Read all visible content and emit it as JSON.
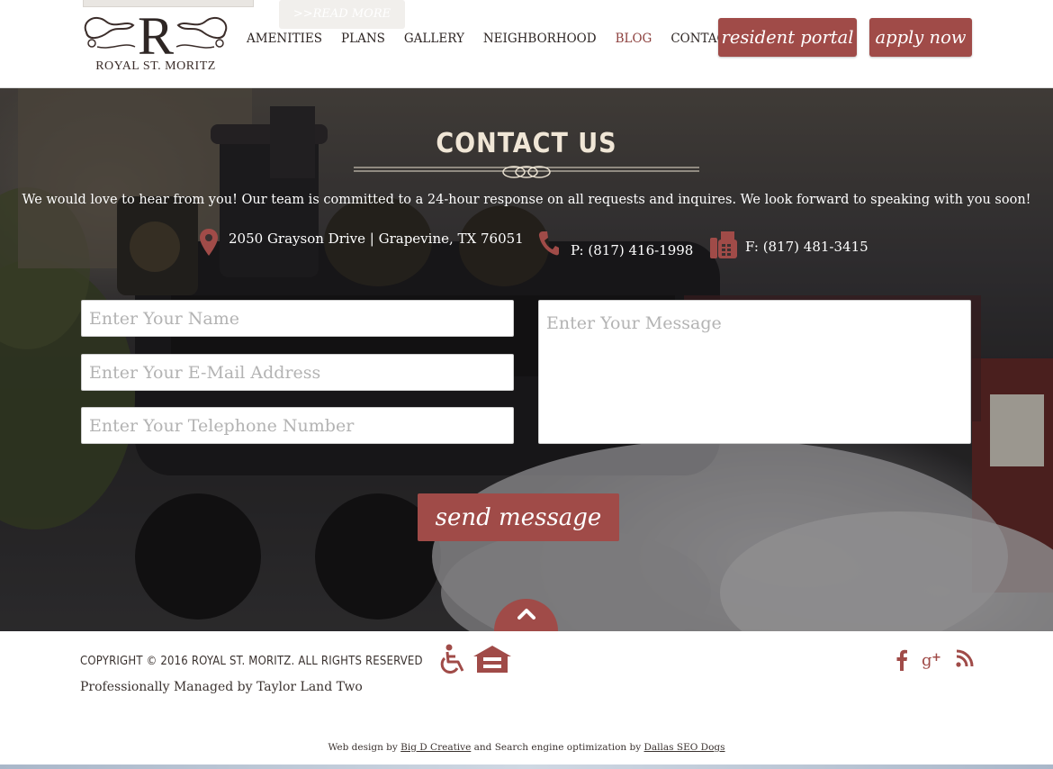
{
  "header": {
    "ghost_read_more": ">>READ MORE",
    "logo_text": "ROYAL ST. MORITZ",
    "logo_letter": "R",
    "nav": [
      {
        "label": "AMENITIES"
      },
      {
        "label": "PLANS"
      },
      {
        "label": "GALLERY"
      },
      {
        "label": "NEIGHBORHOOD"
      },
      {
        "label": "BLOG",
        "active": true
      },
      {
        "label": "CONTACT"
      }
    ],
    "resident_portal": "resident portal",
    "apply_now": "apply now"
  },
  "contact": {
    "title": "CONTACT US",
    "intro": "We would love to hear from you! Our team is committed to a 24-hour response on all requests and inquires. We look forward to speaking with you soon!",
    "address": "2050 Grayson Drive | Grapevine, TX 76051",
    "phone": "P: (817) 416-1998",
    "fax": "F: (817) 481-3415",
    "form": {
      "name_placeholder": "Enter Your Name",
      "email_placeholder": "Enter Your E-Mail Address",
      "phone_placeholder": "Enter Your Telephone Number",
      "message_placeholder": "Enter Your Message",
      "send_label": "send message"
    }
  },
  "footer": {
    "copyright": "COPYRIGHT © 2016 ROYAL ST. MORITZ. ALL RIGHTS RESERVED",
    "managed": "Professionally Managed by Taylor Land Two",
    "credits_prefix": "Web design by",
    "credits_link1": "Big D Creative",
    "credits_middle": "and Search engine optimization by",
    "credits_link2": "Dallas SEO Dogs"
  },
  "icons": {
    "address": "map-pin-icon",
    "phone": "phone-icon",
    "fax": "fax-icon",
    "accessibility": "wheelchair-icon",
    "housing": "equal-housing-icon",
    "facebook": "facebook-icon",
    "googleplus": "google-plus-icon",
    "rss": "rss-icon",
    "back_to_top": "chevron-up-icon"
  },
  "colors": {
    "accent": "#a04b48",
    "title": "#f0e6d6",
    "text_dark": "#3b3330"
  }
}
